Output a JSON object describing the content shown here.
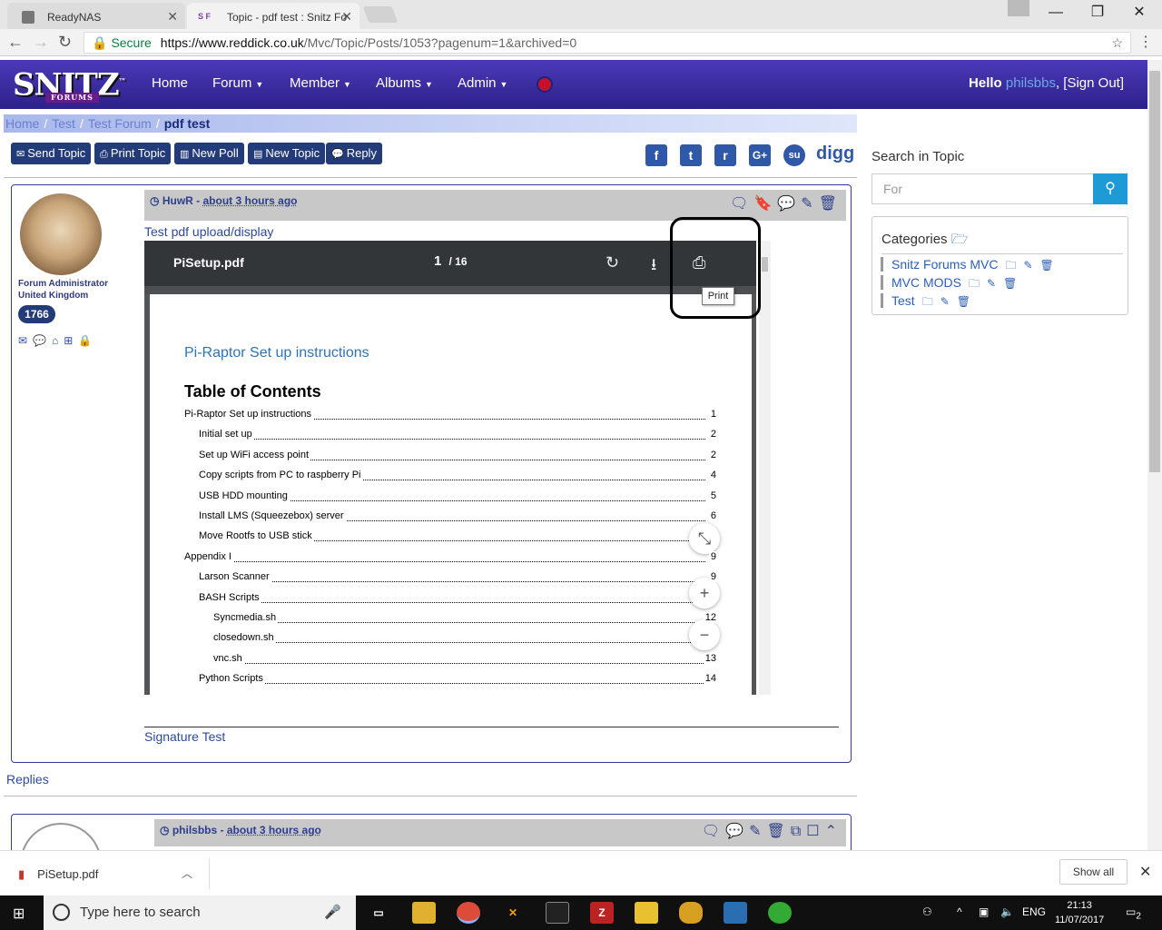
{
  "browser": {
    "tabs": [
      {
        "label": "ReadyNAS"
      },
      {
        "label": "Topic - pdf test : Snitz Fo",
        "favicon": "S F"
      }
    ],
    "secure_label": "Secure",
    "url_host": "https://www.reddick.co.uk",
    "url_path": "/Mvc/Topic/Posts/1053?pagenum=1&archived=0"
  },
  "site": {
    "logo": "SNITZ",
    "logo_sub": "FORUMS",
    "logo_tm": "™",
    "menu": [
      {
        "label": "Home"
      },
      {
        "label": "Forum"
      },
      {
        "label": "Member"
      },
      {
        "label": "Albums"
      },
      {
        "label": "Admin"
      }
    ],
    "hello": "Hello",
    "username": "philsbbs",
    "signout": "[Sign Out]"
  },
  "breadcrumb": [
    {
      "label": "Home"
    },
    {
      "label": "Test"
    },
    {
      "label": "Test Forum"
    },
    {
      "label": "pdf test"
    }
  ],
  "actions": [
    {
      "label": "Send Topic",
      "icon": "✉"
    },
    {
      "label": "Print Topic",
      "icon": "⎙"
    },
    {
      "label": "New Poll",
      "icon": "▥"
    },
    {
      "label": "New Topic",
      "icon": "▤"
    },
    {
      "label": "Reply",
      "icon": "💬"
    }
  ],
  "social": [
    {
      "label": "f",
      "icon": "facebook-icon"
    },
    {
      "label": "t",
      "icon": "twitter-icon"
    },
    {
      "label": "r",
      "icon": "reddit-icon"
    },
    {
      "label": "G+",
      "icon": "google-plus-icon"
    },
    {
      "label": "su",
      "icon": "stumbleupon-icon"
    }
  ],
  "digg": "digg",
  "search": {
    "label": "Search in Topic",
    "placeholder": "For"
  },
  "categories": {
    "title": "Categories",
    "items": [
      {
        "label": "Snitz Forums MVC"
      },
      {
        "label": "MVC MODS"
      },
      {
        "label": "Test"
      }
    ]
  },
  "post": {
    "author": "HuwR",
    "time": "about 3 hours ago",
    "role": "Forum Administrator",
    "country": "United Kingdom",
    "count": "1766",
    "text": "Test pdf upload/display",
    "signature": "Signature Test"
  },
  "pdf": {
    "filename": "PiSetup.pdf",
    "page": "1",
    "total": "/ 16",
    "tooltip": "Print",
    "doc_title": "Pi-Raptor Set up instructions",
    "toc_heading": "Table of Contents",
    "toc": [
      {
        "t": "Pi-Raptor Set up instructions",
        "n": "1",
        "lvl": 0
      },
      {
        "t": "Initial set up",
        "n": "2",
        "lvl": 1
      },
      {
        "t": "Set up WiFi access point",
        "n": "2",
        "lvl": 1
      },
      {
        "t": "Copy scripts from PC to raspberry Pi",
        "n": "4",
        "lvl": 1
      },
      {
        "t": "USB HDD mounting",
        "n": "5",
        "lvl": 1
      },
      {
        "t": "Install LMS (Squeezebox) server",
        "n": "6",
        "lvl": 1
      },
      {
        "t": "Move Rootfs to USB stick",
        "n": "",
        "lvl": 1
      },
      {
        "t": "Appendix I",
        "n": "9",
        "lvl": 0
      },
      {
        "t": "Larson Scanner",
        "n": "9",
        "lvl": 1
      },
      {
        "t": "BASH Scripts",
        "n": "",
        "lvl": 1
      },
      {
        "t": "Syncmedia.sh",
        "n": "12",
        "lvl": 2
      },
      {
        "t": "closedown.sh",
        "n": "",
        "lvl": 2
      },
      {
        "t": "vnc.sh",
        "n": "13",
        "lvl": 2
      },
      {
        "t": "Python Scripts",
        "n": "14",
        "lvl": 1
      }
    ]
  },
  "replies": {
    "label": "Replies",
    "author": "philsbbs",
    "time": "about 3 hours ago"
  },
  "download": {
    "filename": "PiSetup.pdf",
    "show_all": "Show all"
  },
  "taskbar": {
    "search_placeholder": "Type here to search",
    "lang": "ENG",
    "time": "21:13",
    "date": "11/07/2017",
    "notif": "2"
  }
}
